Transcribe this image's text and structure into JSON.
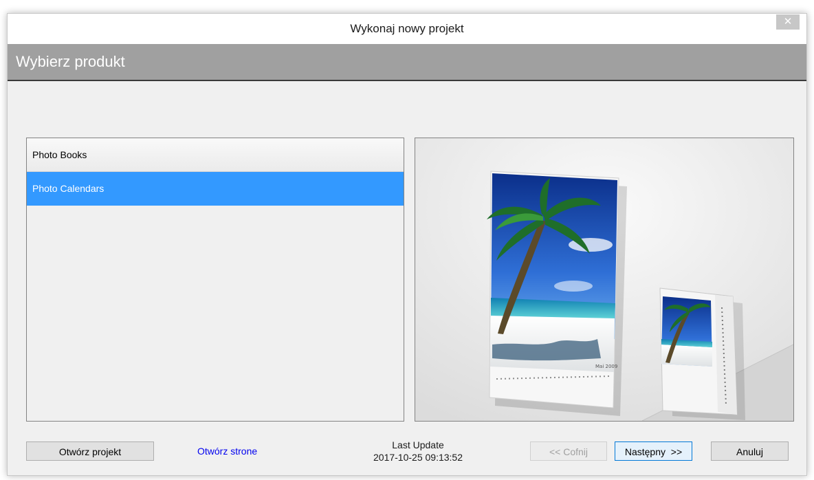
{
  "window": {
    "title": "Wykonaj nowy projekt",
    "close_symbol": "✕"
  },
  "header": {
    "title": "Wybierz produkt"
  },
  "product_list": {
    "items": [
      {
        "label": "Photo Books",
        "selected": false
      },
      {
        "label": "Photo Calendars",
        "selected": true
      }
    ]
  },
  "preview": {
    "calendar_month_label": "Mai 2009"
  },
  "footer": {
    "open_project_label": "Otwórz projekt",
    "open_site_link": "Otwórz strone",
    "last_update_label": "Last Update",
    "last_update_value": "2017-10-25 09:13:52",
    "back_label": "<< Cofnij",
    "next_label": "Następny  >>",
    "cancel_label": "Anuluj"
  },
  "colors": {
    "selection": "#3399ff",
    "header_band": "#a0a0a0",
    "link": "#0000ee"
  }
}
